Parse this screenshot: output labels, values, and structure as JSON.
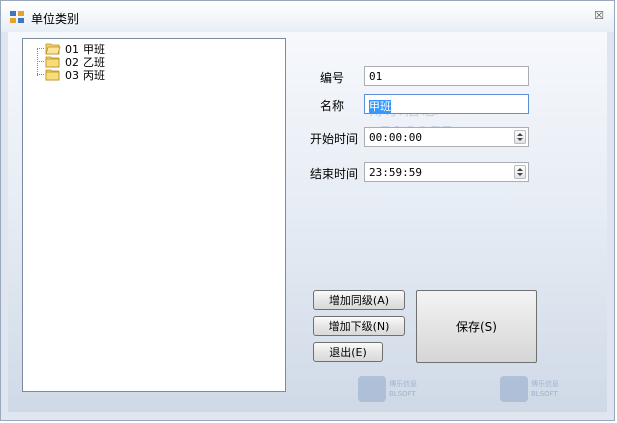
{
  "window": {
    "title": "单位类别",
    "close_glyph": "☒"
  },
  "tree": {
    "items": [
      {
        "code": "01",
        "name": "甲班",
        "icon": "folder-open-icon"
      },
      {
        "code": "02",
        "name": "乙班",
        "icon": "folder-icon"
      },
      {
        "code": "03",
        "name": "丙班",
        "icon": "folder-icon"
      }
    ]
  },
  "form": {
    "code_label": "编号",
    "code_value": "01",
    "name_label": "名称",
    "name_value": "甲班",
    "start_label": "开始时间",
    "start_value": "00:00:00",
    "end_label": "结束时间",
    "end_value": "23:59:59"
  },
  "buttons": {
    "add_sibling": "增加同级(A)",
    "add_child": "增加下级(N)",
    "exit": "退出(E)",
    "save": "保存(S)"
  },
  "watermark": {
    "text": "博乐信息",
    "sub": "BLSOFT"
  },
  "colors": {
    "accent": "#3399ff",
    "border": "#9aa8bd"
  }
}
